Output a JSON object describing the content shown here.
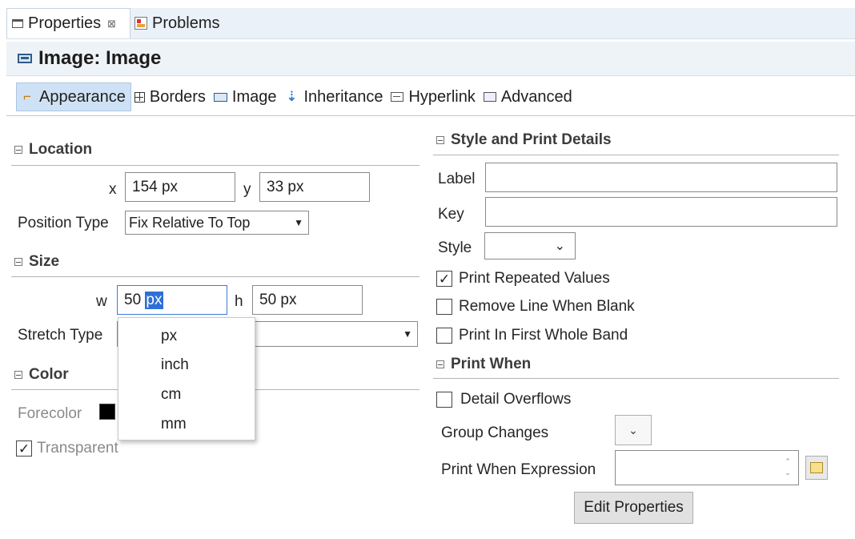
{
  "tabs": {
    "properties_label": "Properties",
    "properties_close": "⊠",
    "problems_label": "Problems"
  },
  "title": "Image: Image",
  "inner_tabs": [
    "Appearance",
    "Borders",
    "Image",
    "Inheritance",
    "Hyperlink",
    "Advanced"
  ],
  "location": {
    "header": "Location",
    "x_label": "x",
    "x_value": "154 px",
    "y_label": "y",
    "y_value": "33 px",
    "position_type_label": "Position Type",
    "position_type_value": "Fix Relative To Top"
  },
  "size": {
    "header": "Size",
    "w_label": "w",
    "w_value_num": "50 ",
    "w_value_unit": "px",
    "h_label": "h",
    "h_value": "50 px",
    "stretch_type_label": "Stretch Type"
  },
  "unit_popup": {
    "options": [
      "px",
      "inch",
      "cm",
      "mm"
    ]
  },
  "color": {
    "header": "Color",
    "forecolor_label": "Forecolor",
    "forecolor_value": "#000000",
    "transparent_label": "Transparent",
    "transparent_checked": true
  },
  "style_print": {
    "header": "Style and Print Details",
    "label_label": "Label",
    "label_value": "",
    "key_label": "Key",
    "key_value": "",
    "style_label": "Style",
    "print_repeated_label": "Print Repeated Values",
    "print_repeated_checked": true,
    "remove_line_label": "Remove Line When Blank",
    "remove_line_checked": false,
    "print_first_band_label": "Print In First Whole Band",
    "print_first_band_checked": false
  },
  "print_when": {
    "header": "Print When",
    "detail_overflows_label": "Detail Overflows",
    "detail_overflows_checked": false,
    "group_changes_label": "Group Changes",
    "expression_label": "Print When Expression",
    "edit_properties_label": "Edit Properties"
  }
}
